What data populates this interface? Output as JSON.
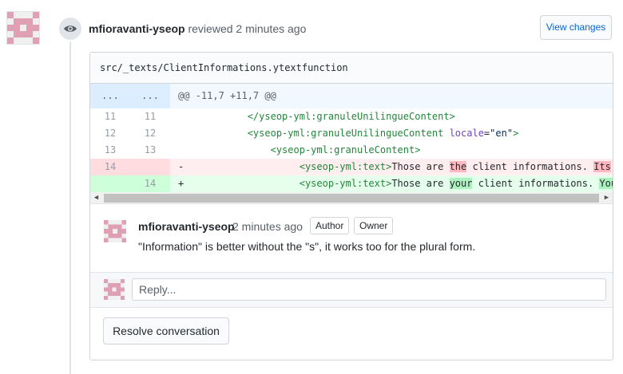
{
  "colors": {
    "avatar_pink": "#e0a0b4",
    "link_blue": "#0366d6",
    "del_bg": "#ffeef0",
    "add_bg": "#e6ffed"
  },
  "review": {
    "author": "mfioravanti-yseop",
    "action": "reviewed",
    "time": "2 minutes ago",
    "badge_icon": "eye-icon",
    "view_changes_label": "View changes"
  },
  "file": {
    "path": "src/_texts/ClientInformations.ytextfunction"
  },
  "diff": {
    "hunk": {
      "left": "...",
      "right": "...",
      "header": "@@ -11,7 +11,7 @@"
    },
    "rows": [
      {
        "left": "11",
        "right": "11",
        "indent": "            ",
        "tag": "</yseop-yml:granuleUnilingueContent>"
      },
      {
        "left": "12",
        "right": "12",
        "indent": "            ",
        "tag": "<yseop-yml:granuleUnilingueContent",
        "attr": " locale",
        "eq": "=",
        "val": "\"en\"",
        "close": ">"
      },
      {
        "left": "13",
        "right": "13",
        "indent": "                ",
        "tag": "<yseop-yml:granuleContent>"
      }
    ],
    "del": {
      "left": "14",
      "right": "",
      "marker": "-",
      "indent": "                    ",
      "tag": "<yseop-yml:text>",
      "pre": "Those are ",
      "hl1": "the",
      "mid": " client informations. ",
      "hl2": "Its",
      "post": " r"
    },
    "add": {
      "left": "",
      "right": "14",
      "marker": "+",
      "indent": "                    ",
      "tag": "<yseop-yml:text>",
      "pre": "Those are ",
      "hl1": "your",
      "mid": " client informations. ",
      "hl2": "Your",
      "post": ""
    }
  },
  "comment": {
    "author": "mfioravanti-yseop",
    "time": "2 minutes ago",
    "badges": [
      "Author",
      "Owner"
    ],
    "body": "\"Information\" is better without the \"s\", it works too for the plural form."
  },
  "reply": {
    "placeholder": "Reply..."
  },
  "resolve_label": "Resolve conversation"
}
